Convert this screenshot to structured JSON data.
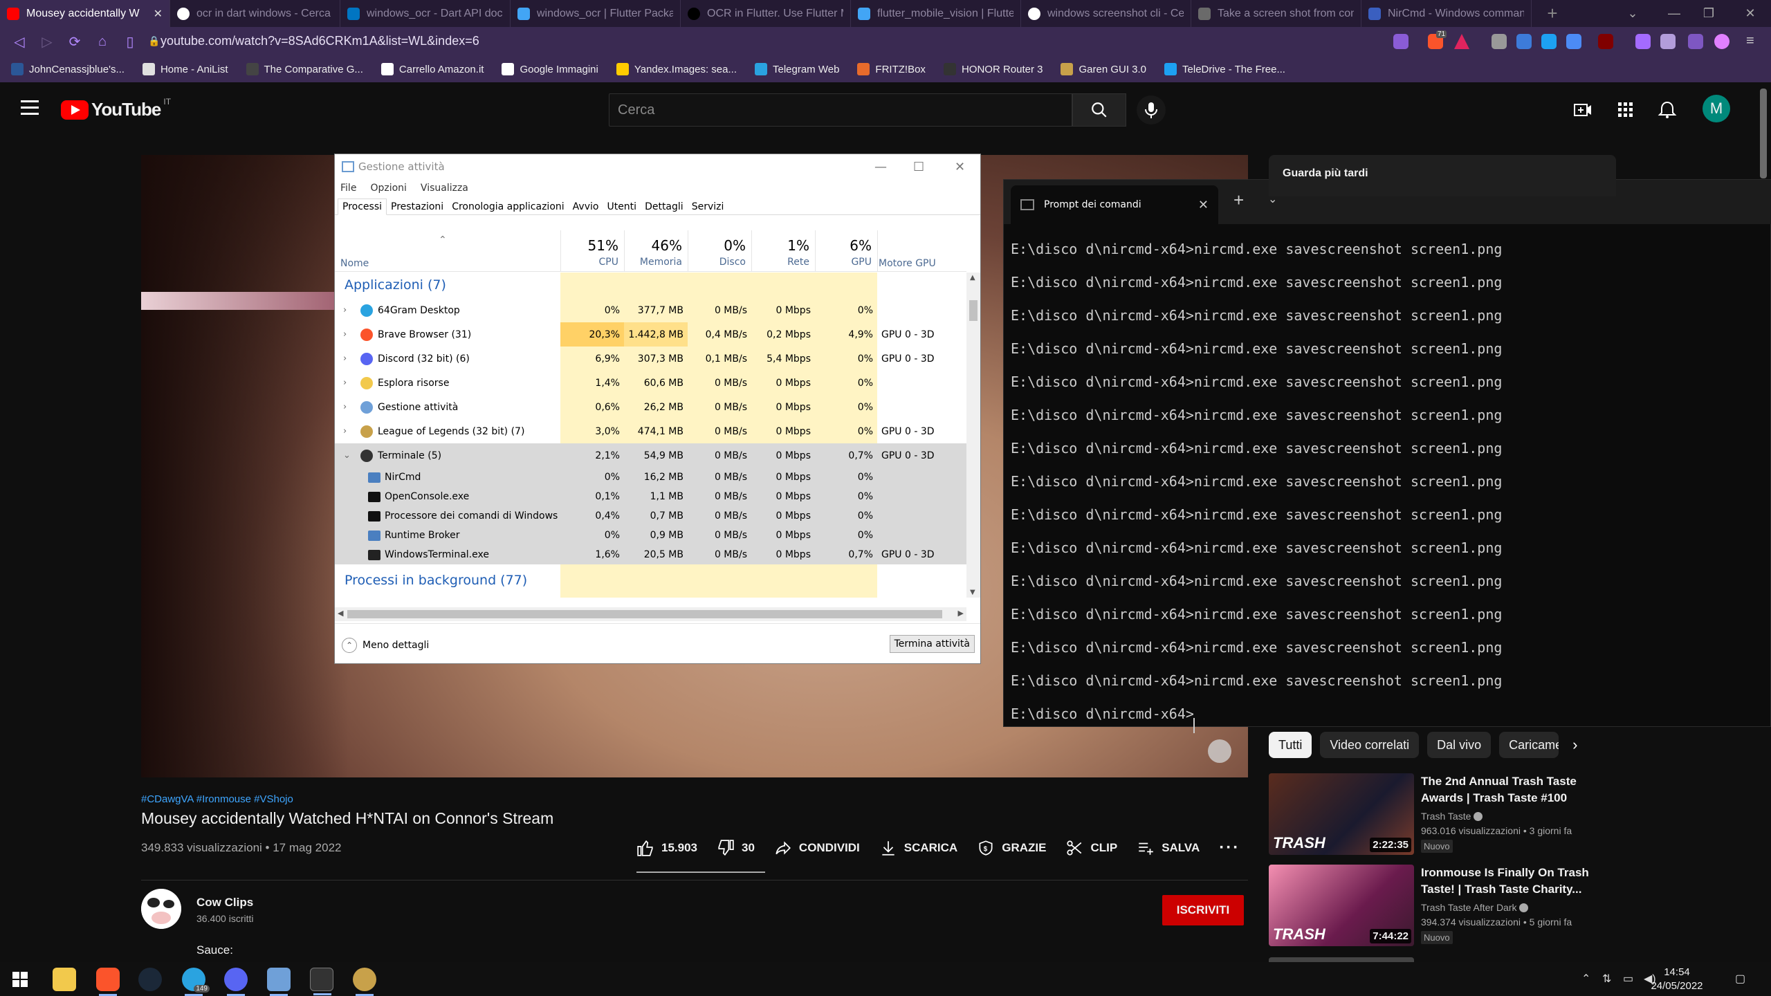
{
  "browser": {
    "tabs": [
      {
        "title": "Mousey accidentally W",
        "favicon": "youtube-red",
        "active": true
      },
      {
        "title": "ocr in dart windows - Cerca c",
        "favicon": "google"
      },
      {
        "title": "windows_ocr - Dart API docs",
        "favicon": "dart"
      },
      {
        "title": "windows_ocr | Flutter Package",
        "favicon": "flutter"
      },
      {
        "title": "OCR in Flutter. Use Flutter Mo",
        "favicon": "medium"
      },
      {
        "title": "flutter_mobile_vision | Flutter",
        "favicon": "flutter"
      },
      {
        "title": "windows screenshot cli - Cerca",
        "favicon": "google"
      },
      {
        "title": "Take a screen shot from comm",
        "favicon": "generic"
      },
      {
        "title": "NirCmd - Windows command",
        "favicon": "nircmd-n"
      }
    ],
    "new_tab": "+",
    "url": "youtube.com/watch?v=8SAd6CRKm1A&list=WL&index=6",
    "extension_badge": "71",
    "bookmarks": [
      "JohnCenassjblue's...",
      "Home - AniList",
      "The Comparative G...",
      "Carrello Amazon.it",
      "Google Immagini",
      "Yandex.Images: sea...",
      "Telegram Web",
      "FRITZ!Box",
      "HONOR Router 3",
      "Garen GUI 3.0",
      "TeleDrive - The Free..."
    ]
  },
  "youtube": {
    "logo_text": "YouTube",
    "country_code": "IT",
    "search_placeholder": "Cerca",
    "avatar_letter": "M",
    "watch_later": "Guarda più tardi",
    "chips": [
      "Tutti",
      "Video correlati",
      "Dal vivo",
      "Caricame"
    ],
    "video": {
      "tags": "#CDawgVA #Ironmouse #VShojo",
      "title": "Mousey accidentally Watched H*NTAI on Connor's Stream",
      "views_date": "349.833 visualizzazioni • 17 mag 2022",
      "likes": "15.903",
      "dislikes": "30",
      "share": "CONDIVIDI",
      "download": "SCARICA",
      "thanks": "GRAZIE",
      "clip": "CLIP",
      "save": "SALVA"
    },
    "channel": {
      "name": "Cow Clips",
      "subs": "36.400 iscritti",
      "subscribe": "ISCRIVITI",
      "desc_start": "Sauce:"
    },
    "recs": [
      {
        "title": "The 2nd Annual Trash Taste Awards | Trash Taste #100",
        "channel": "Trash Taste",
        "meta": "963.016 visualizzazioni • 3 giorni fa",
        "badge": "Nuovo",
        "duration": "2:22:35",
        "thumb_text": "TRASH"
      },
      {
        "title": "Ironmouse Is Finally On Trash Taste! | Trash Taste Charity...",
        "channel": "Trash Taste After Dark",
        "meta": "394.374 visualizzazioni • 5 giorni fa",
        "badge": "Nuovo",
        "duration": "7:44:22",
        "thumb_text": "TRASH"
      }
    ]
  },
  "taskmgr": {
    "title": "Gestione attività",
    "menu": [
      "File",
      "Opzioni",
      "Visualizza"
    ],
    "tabs": [
      "Processi",
      "Prestazioni",
      "Cronologia applicazioni",
      "Avvio",
      "Utenti",
      "Dettagli",
      "Servizi"
    ],
    "col_name": "Nome",
    "columns": [
      {
        "pct": "51%",
        "label": "CPU"
      },
      {
        "pct": "46%",
        "label": "Memoria"
      },
      {
        "pct": "0%",
        "label": "Disco"
      },
      {
        "pct": "1%",
        "label": "Rete"
      },
      {
        "pct": "6%",
        "label": "GPU"
      }
    ],
    "col_gpu_engine": "Motore GPU",
    "group_apps": "Applicazioni (7)",
    "group_bg": "Processi in background (77)",
    "rows": [
      {
        "name": "64Gram Desktop",
        "cpu": "0%",
        "mem": "377,7 MB",
        "disk": "0 MB/s",
        "net": "0 Mbps",
        "gpu": "0%",
        "engine": "",
        "icon": "#2aa3e0"
      },
      {
        "name": "Brave Browser (31)",
        "cpu": "20,3%",
        "mem": "1.442,8 MB",
        "disk": "0,4 MB/s",
        "net": "0,2 Mbps",
        "gpu": "4,9%",
        "engine": "GPU 0 - 3D",
        "icon": "#fb542b"
      },
      {
        "name": "Discord (32 bit) (6)",
        "cpu": "6,9%",
        "mem": "307,3 MB",
        "disk": "0,1 MB/s",
        "net": "5,4 Mbps",
        "gpu": "0%",
        "engine": "GPU 0 - 3D",
        "icon": "#5865f2"
      },
      {
        "name": "Esplora risorse",
        "cpu": "1,4%",
        "mem": "60,6 MB",
        "disk": "0 MB/s",
        "net": "0 Mbps",
        "gpu": "0%",
        "engine": "",
        "icon": "#f2c94c"
      },
      {
        "name": "Gestione attività",
        "cpu": "0,6%",
        "mem": "26,2 MB",
        "disk": "0 MB/s",
        "net": "0 Mbps",
        "gpu": "0%",
        "engine": "",
        "icon": "#6fa0d8"
      },
      {
        "name": "League of Legends (32 bit) (7)",
        "cpu": "3,0%",
        "mem": "474,1 MB",
        "disk": "0 MB/s",
        "net": "0 Mbps",
        "gpu": "0%",
        "engine": "GPU 0 - 3D",
        "icon": "#c8a14a"
      },
      {
        "name": "Terminale (5)",
        "cpu": "2,1%",
        "mem": "54,9 MB",
        "disk": "0 MB/s",
        "net": "0 Mbps",
        "gpu": "0,7%",
        "engine": "GPU 0 - 3D",
        "icon": "#333333"
      }
    ],
    "subrows": [
      {
        "name": "NirCmd",
        "cpu": "0%",
        "mem": "16,2 MB",
        "disk": "0 MB/s",
        "net": "0 Mbps",
        "gpu": "0%",
        "engine": "",
        "icon": "#4a7fc0"
      },
      {
        "name": "OpenConsole.exe",
        "cpu": "0,1%",
        "mem": "1,1 MB",
        "disk": "0 MB/s",
        "net": "0 Mbps",
        "gpu": "0%",
        "engine": "",
        "icon": "#111111"
      },
      {
        "name": "Processore dei comandi di Windows",
        "cpu": "0,4%",
        "mem": "0,7 MB",
        "disk": "0 MB/s",
        "net": "0 Mbps",
        "gpu": "0%",
        "engine": "",
        "icon": "#111111"
      },
      {
        "name": "Runtime Broker",
        "cpu": "0%",
        "mem": "0,9 MB",
        "disk": "0 MB/s",
        "net": "0 Mbps",
        "gpu": "0%",
        "engine": "",
        "icon": "#4a7fc0"
      },
      {
        "name": "WindowsTerminal.exe",
        "cpu": "1,6%",
        "mem": "20,5 MB",
        "disk": "0 MB/s",
        "net": "0 Mbps",
        "gpu": "0,7%",
        "engine": "GPU 0 - 3D",
        "icon": "#222222"
      }
    ],
    "less_details": "Meno dettagli",
    "end_task": "Termina attività"
  },
  "terminal": {
    "tab_title": "Prompt dei comandi",
    "lines": [
      "E:\\disco d\\nircmd-x64>nircmd.exe savescreenshot screen1.png",
      "E:\\disco d\\nircmd-x64>nircmd.exe savescreenshot screen1.png",
      "E:\\disco d\\nircmd-x64>nircmd.exe savescreenshot screen1.png",
      "E:\\disco d\\nircmd-x64>nircmd.exe savescreenshot screen1.png",
      "E:\\disco d\\nircmd-x64>nircmd.exe savescreenshot screen1.png",
      "E:\\disco d\\nircmd-x64>nircmd.exe savescreenshot screen1.png",
      "E:\\disco d\\nircmd-x64>nircmd.exe savescreenshot screen1.png",
      "E:\\disco d\\nircmd-x64>nircmd.exe savescreenshot screen1.png",
      "E:\\disco d\\nircmd-x64>nircmd.exe savescreenshot screen1.png",
      "E:\\disco d\\nircmd-x64>nircmd.exe savescreenshot screen1.png",
      "E:\\disco d\\nircmd-x64>nircmd.exe savescreenshot screen1.png",
      "E:\\disco d\\nircmd-x64>nircmd.exe savescreenshot screen1.png",
      "E:\\disco d\\nircmd-x64>nircmd.exe savescreenshot screen1.png",
      "E:\\disco d\\nircmd-x64>nircmd.exe savescreenshot screen1.png",
      "E:\\disco d\\nircmd-x64>"
    ]
  },
  "taskbar": {
    "time": "14:54",
    "date": "24/05/2022",
    "telegram_badge": "149"
  }
}
